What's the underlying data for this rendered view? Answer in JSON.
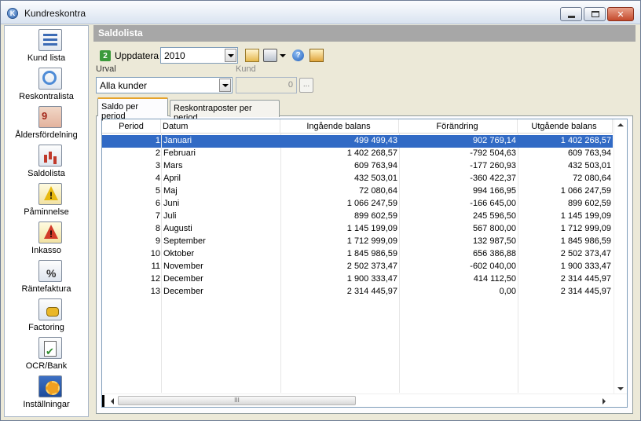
{
  "window": {
    "title": "Kundreskontra",
    "close_glyph": "✕",
    "app_icon_glyph": "K"
  },
  "sidebar": {
    "items": [
      {
        "label": "Kund lista",
        "icon": "customer-list-icon"
      },
      {
        "label": "Reskontralista",
        "icon": "ledger-search-icon"
      },
      {
        "label": "Åldersfördelning",
        "icon": "calendar-icon"
      },
      {
        "label": "Saldolista",
        "icon": "balance-chart-icon"
      },
      {
        "label": "Påminnelse",
        "icon": "reminder-warning-icon"
      },
      {
        "label": "Inkasso",
        "icon": "collection-warning-icon"
      },
      {
        "label": "Räntefaktura",
        "icon": "interest-percent-icon"
      },
      {
        "label": "Factoring",
        "icon": "factoring-money-icon"
      },
      {
        "label": "OCR/Bank",
        "icon": "ocr-bank-icon"
      },
      {
        "label": "Inställningar",
        "icon": "settings-icon"
      }
    ]
  },
  "main": {
    "header": "Saldolista",
    "toolbar": {
      "refresh_label": "Uppdatera",
      "refresh_glyph": "2",
      "year_value": "2010",
      "help_glyph": "?"
    },
    "filters": {
      "urval_label": "Urval",
      "urval_value": "Alla kunder",
      "kund_label": "Kund",
      "kund_value": "0",
      "browse_label": "..."
    },
    "tabs": [
      {
        "label": "Saldo per period",
        "active": true
      },
      {
        "label": "Reskontraposter per period",
        "active": false
      }
    ],
    "scroll_grip": "III"
  },
  "table": {
    "columns": [
      "Period",
      "Datum",
      "Ingående balans",
      "Förändring",
      "Utgående balans"
    ],
    "rows": [
      {
        "period": "1",
        "datum": "Januari",
        "ib": "499 499,43",
        "for": "902 769,14",
        "ub": "1 402 268,57"
      },
      {
        "period": "2",
        "datum": "Februari",
        "ib": "1 402 268,57",
        "for": "-792 504,63",
        "ub": "609 763,94"
      },
      {
        "period": "3",
        "datum": "Mars",
        "ib": "609 763,94",
        "for": "-177 260,93",
        "ub": "432 503,01"
      },
      {
        "period": "4",
        "datum": "April",
        "ib": "432 503,01",
        "for": "-360 422,37",
        "ub": "72 080,64"
      },
      {
        "period": "5",
        "datum": "Maj",
        "ib": "72 080,64",
        "for": "994 166,95",
        "ub": "1 066 247,59"
      },
      {
        "period": "6",
        "datum": "Juni",
        "ib": "1 066 247,59",
        "for": "-166 645,00",
        "ub": "899 602,59"
      },
      {
        "period": "7",
        "datum": "Juli",
        "ib": "899 602,59",
        "for": "245 596,50",
        "ub": "1 145 199,09"
      },
      {
        "period": "8",
        "datum": "Augusti",
        "ib": "1 145 199,09",
        "for": "567 800,00",
        "ub": "1 712 999,09"
      },
      {
        "period": "9",
        "datum": "September",
        "ib": "1 712 999,09",
        "for": "132 987,50",
        "ub": "1 845 986,59"
      },
      {
        "period": "10",
        "datum": "Oktober",
        "ib": "1 845 986,59",
        "for": "656 386,88",
        "ub": "2 502 373,47"
      },
      {
        "period": "11",
        "datum": "November",
        "ib": "2 502 373,47",
        "for": "-602 040,00",
        "ub": "1 900 333,47"
      },
      {
        "period": "12",
        "datum": "December",
        "ib": "1 900 333,47",
        "for": "414 112,50",
        "ub": "2 314 445,97"
      },
      {
        "period": "13",
        "datum": "December",
        "ib": "2 314 445,97",
        "for": "0,00",
        "ub": "2 314 445,97"
      }
    ],
    "selected_row": 0
  },
  "colors": {
    "selection": "#316ac5",
    "header_bar": "#a7a7a7",
    "window_bg": "#ece9d8"
  }
}
